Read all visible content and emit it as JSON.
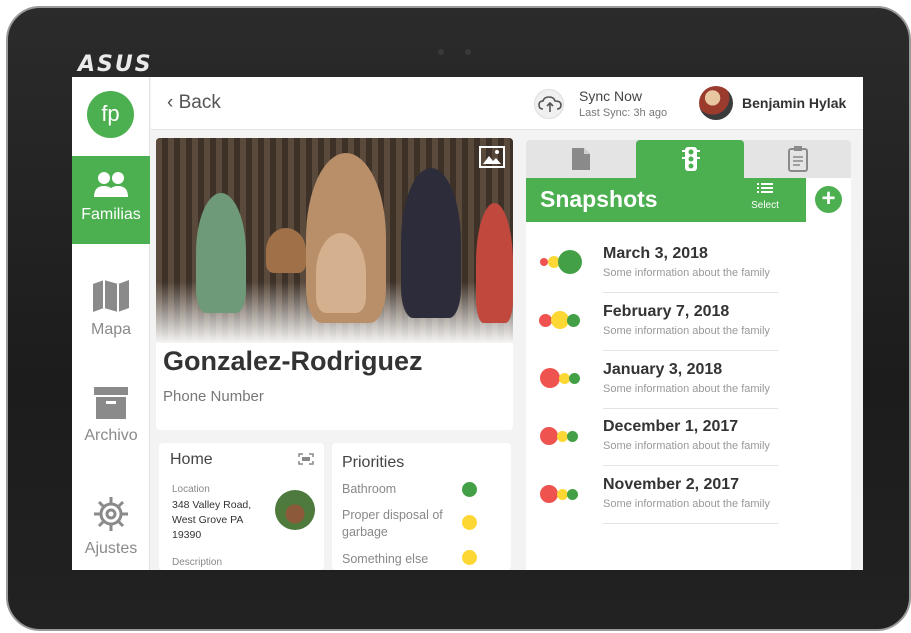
{
  "device": {
    "brand": "ASUS"
  },
  "colors": {
    "accent": "#4caf50",
    "red": "#ef5350",
    "yellow": "#fdd835",
    "green": "#43a047"
  },
  "sidebar": {
    "logo": "fp",
    "items": [
      {
        "label": "Familias",
        "icon": "users-icon",
        "active": true
      },
      {
        "label": "Mapa",
        "icon": "map-icon",
        "active": false
      },
      {
        "label": "Archivo",
        "icon": "archive-icon",
        "active": false
      },
      {
        "label": "Ajustes",
        "icon": "gear-icon",
        "active": false
      }
    ]
  },
  "topbar": {
    "back_label": "Back",
    "sync_title": "Sync Now",
    "sync_sub": "Last Sync: 3h ago",
    "user_name": "Benjamin Hylak"
  },
  "family": {
    "name": "Gonzalez-Rodriguez",
    "phone_label": "Phone Number"
  },
  "home": {
    "title": "Home",
    "location_label": "Location",
    "location_value": "348 Valley Road, West Grove PA 19390",
    "description_label": "Description"
  },
  "priorities": {
    "title": "Priorities",
    "items": [
      {
        "label": "Bathroom",
        "status": "green"
      },
      {
        "label": "Proper disposal of garbage",
        "status": "yellow"
      },
      {
        "label": "Something else",
        "status": "yellow"
      }
    ]
  },
  "snapshots": {
    "title": "Snapshots",
    "select_label": "Select",
    "items": [
      {
        "date": "March 3, 2018",
        "info": "Some information about the family",
        "dominant": "green"
      },
      {
        "date": "February 7, 2018",
        "info": "Some information about the family",
        "dominant": "yellow"
      },
      {
        "date": "January 3, 2018",
        "info": "Some information about the family",
        "dominant": "red"
      },
      {
        "date": "December 1, 2017",
        "info": "Some information about the family",
        "dominant": "red"
      },
      {
        "date": "November 2, 2017",
        "info": "Some information about the family",
        "dominant": "red"
      }
    ]
  }
}
